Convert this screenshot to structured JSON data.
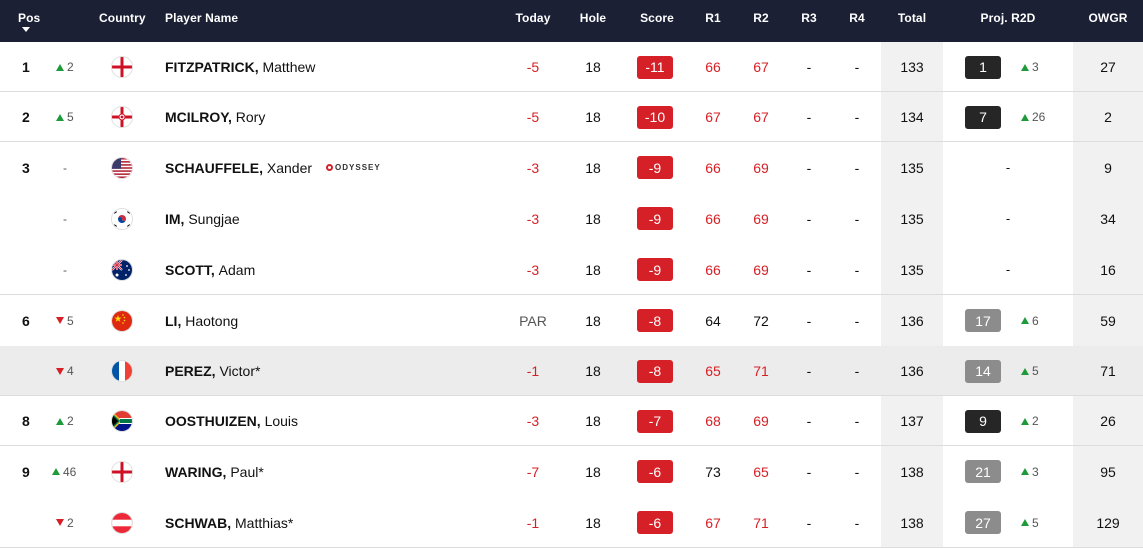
{
  "header": {
    "pos": "Pos",
    "country": "Country",
    "player_name": "Player Name",
    "today": "Today",
    "hole": "Hole",
    "score": "Score",
    "r1": "R1",
    "r2": "R2",
    "r3": "R3",
    "r4": "R4",
    "total": "Total",
    "proj": "Proj. R2D",
    "owgr": "OWGR"
  },
  "colors": {
    "header_bg": "#1b2035",
    "score_red": "#d62027",
    "up_green": "#1f9a3a",
    "proj_black": "#262626",
    "proj_grey": "#8c8c8c"
  },
  "rows": [
    {
      "pos": "1",
      "move": "2",
      "dir": "up",
      "flag": "england",
      "last": "FITZPATRICK,",
      "first": "Matthew",
      "today": "-5",
      "hole": "18",
      "score": "-11",
      "r1": "66",
      "r2": "67",
      "r3": "-",
      "r4": "-",
      "total": "133",
      "proj": "1",
      "proj_style": "black",
      "proj_move": "3",
      "proj_dir": "up",
      "owgr": "27"
    },
    {
      "pos": "2",
      "move": "5",
      "dir": "up",
      "flag": "northern-ireland",
      "last": "MCILROY,",
      "first": "Rory",
      "today": "-5",
      "hole": "18",
      "score": "-10",
      "r1": "67",
      "r2": "67",
      "r3": "-",
      "r4": "-",
      "total": "134",
      "proj": "7",
      "proj_style": "black",
      "proj_move": "26",
      "proj_dir": "up",
      "owgr": "2"
    },
    {
      "pos": "3",
      "move": "-",
      "dir": "none",
      "flag": "usa",
      "last": "SCHAUFFELE,",
      "first": "Xander",
      "sponsor": "ODYSSEY",
      "today": "-3",
      "hole": "18",
      "score": "-9",
      "r1": "66",
      "r2": "69",
      "r3": "-",
      "r4": "-",
      "total": "135",
      "proj": "-",
      "proj_style": "none",
      "proj_move": "",
      "proj_dir": "none",
      "owgr": "9"
    },
    {
      "pos": "",
      "move": "-",
      "dir": "none",
      "flag": "korea",
      "last": "IM,",
      "first": "Sungjae",
      "today": "-3",
      "hole": "18",
      "score": "-9",
      "r1": "66",
      "r2": "69",
      "r3": "-",
      "r4": "-",
      "total": "135",
      "proj": "-",
      "proj_style": "none",
      "proj_move": "",
      "proj_dir": "none",
      "owgr": "34"
    },
    {
      "pos": "",
      "move": "-",
      "dir": "none",
      "flag": "australia",
      "last": "SCOTT,",
      "first": "Adam",
      "today": "-3",
      "hole": "18",
      "score": "-9",
      "r1": "66",
      "r2": "69",
      "r3": "-",
      "r4": "-",
      "total": "135",
      "proj": "-",
      "proj_style": "none",
      "proj_move": "",
      "proj_dir": "none",
      "owgr": "16"
    },
    {
      "pos": "6",
      "move": "5",
      "dir": "down",
      "flag": "china",
      "last": "LI,",
      "first": "Haotong",
      "today": "PAR",
      "hole": "18",
      "score": "-8",
      "r1": "64",
      "r2": "72",
      "r3": "-",
      "r4": "-",
      "total": "136",
      "proj": "17",
      "proj_style": "grey",
      "proj_move": "6",
      "proj_dir": "up",
      "owgr": "59"
    },
    {
      "pos": "",
      "move": "4",
      "dir": "down",
      "flag": "france",
      "last": "PEREZ,",
      "first": "Victor*",
      "today": "-1",
      "hole": "18",
      "score": "-8",
      "r1": "65",
      "r2": "71",
      "r3": "-",
      "r4": "-",
      "total": "136",
      "proj": "14",
      "proj_style": "grey",
      "proj_move": "5",
      "proj_dir": "up",
      "owgr": "71"
    },
    {
      "pos": "8",
      "move": "2",
      "dir": "up",
      "flag": "south-africa",
      "last": "OOSTHUIZEN,",
      "first": "Louis",
      "today": "-3",
      "hole": "18",
      "score": "-7",
      "r1": "68",
      "r2": "69",
      "r3": "-",
      "r4": "-",
      "total": "137",
      "proj": "9",
      "proj_style": "black",
      "proj_move": "2",
      "proj_dir": "up",
      "owgr": "26"
    },
    {
      "pos": "9",
      "move": "46",
      "dir": "up",
      "flag": "england",
      "last": "WARING,",
      "first": "Paul*",
      "today": "-7",
      "hole": "18",
      "score": "-6",
      "r1": "73",
      "r2": "65",
      "r3": "-",
      "r4": "-",
      "total": "138",
      "proj": "21",
      "proj_style": "grey",
      "proj_move": "3",
      "proj_dir": "up",
      "owgr": "95"
    },
    {
      "pos": "",
      "move": "2",
      "dir": "down",
      "flag": "austria",
      "last": "SCHWAB,",
      "first": "Matthias*",
      "today": "-1",
      "hole": "18",
      "score": "-6",
      "r1": "67",
      "r2": "71",
      "r3": "-",
      "r4": "-",
      "total": "138",
      "proj": "27",
      "proj_style": "grey",
      "proj_move": "5",
      "proj_dir": "up",
      "owgr": "129"
    }
  ]
}
